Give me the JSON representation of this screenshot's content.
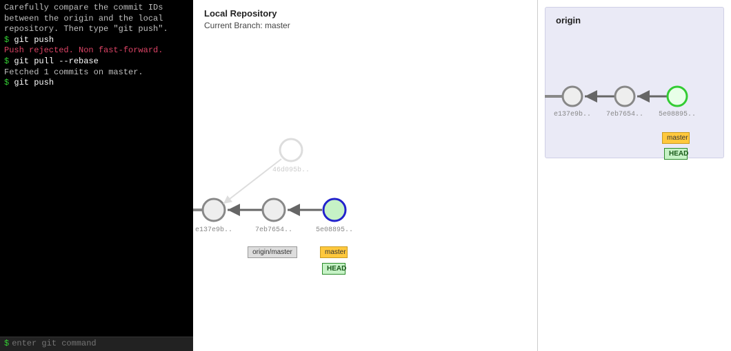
{
  "terminal": {
    "instruction": "Carefully compare the commit IDs between the origin and the local repository. Then type \"git push\".",
    "lines": [
      {
        "prompt": "$",
        "cmd": "git push"
      },
      {
        "out": "Push rejected. Non fast-forward.",
        "cls": "err"
      },
      {
        "prompt": "$",
        "cmd": "git pull --rebase"
      },
      {
        "out": "Fetched 1 commits on master.",
        "cls": "ok"
      },
      {
        "prompt": "$",
        "cmd": "git push"
      }
    ],
    "input_placeholder": "enter git command",
    "input_prompt": "$"
  },
  "local": {
    "title": "Local Repository",
    "subtitle": "Current Branch: master",
    "commits": {
      "c1": "e137e9b..",
      "c2": "7eb7654..",
      "c3": "5e08895..",
      "orphan": "46d095b.."
    },
    "tags": {
      "origin_master": "origin/master",
      "master": "master",
      "head": "HEAD"
    }
  },
  "origin": {
    "title": "origin",
    "commits": {
      "c1": "e137e9b..",
      "c2": "7eb7654..",
      "c3": "5e08895.."
    },
    "tags": {
      "master": "master",
      "head": "HEAD"
    }
  },
  "colors": {
    "commit_fill": "#eeeeee",
    "commit_stroke": "#888888",
    "head_fill_local": "#c6f2c6",
    "head_stroke_local": "#2222cc",
    "head_fill_origin": "#e0ffe0",
    "head_stroke_origin": "#3c3",
    "orphan_fill": "#ffffff",
    "orphan_stroke": "#dddddd",
    "arrow": "#666666"
  }
}
